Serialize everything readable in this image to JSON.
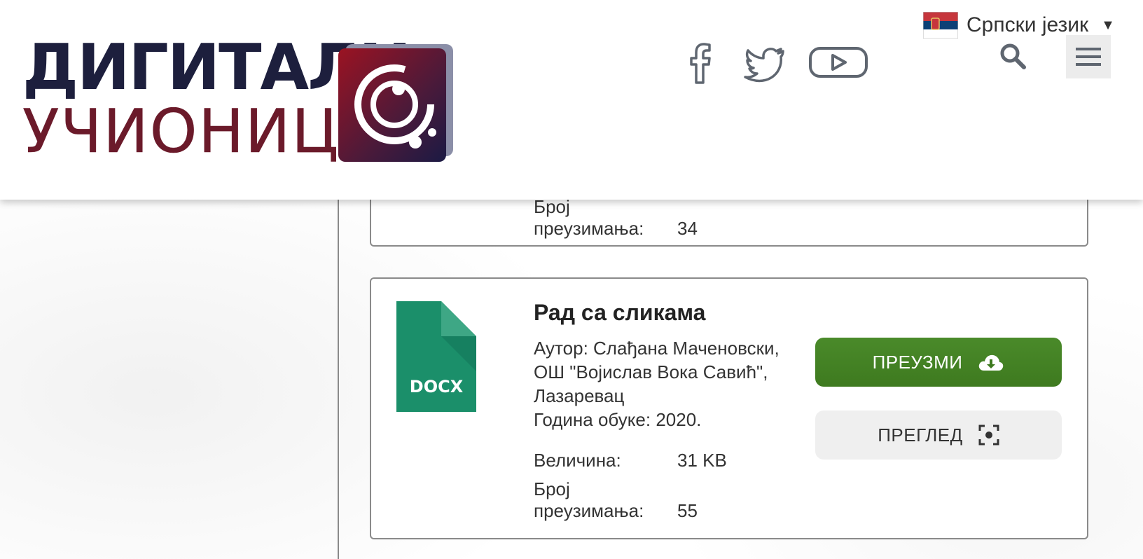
{
  "header": {
    "logo_line1": "ДИГИТАЛН",
    "logo_line2": "УЧИОНИЦ",
    "social": [
      "facebook-icon",
      "twitter-icon",
      "youtube-icon"
    ],
    "language": "Српски језик",
    "language_caret": "▼"
  },
  "previous_card": {
    "downloads_label": "Број преузимања:",
    "downloads_value": "34"
  },
  "file": {
    "icon_label": "DOCX",
    "title": "Рад са сликама",
    "author_line": "Аутор: Слађана Маченовски, ОШ \"Војислав Вока Савић\", Лазаревац",
    "year_line": "Година обуке: 2020.",
    "size_label": "Величина:",
    "size_value": "31 KB",
    "downloads_label": "Број преузимања:",
    "downloads_value": "55",
    "download_button": "ПРЕУЗМИ",
    "preview_button": "ПРЕГЛЕД"
  },
  "colors": {
    "primary_green": "#43822a",
    "logo_navy": "#1d1f3d",
    "logo_maroon": "#6b1a2a",
    "docx_green": "#1b8f6a"
  }
}
